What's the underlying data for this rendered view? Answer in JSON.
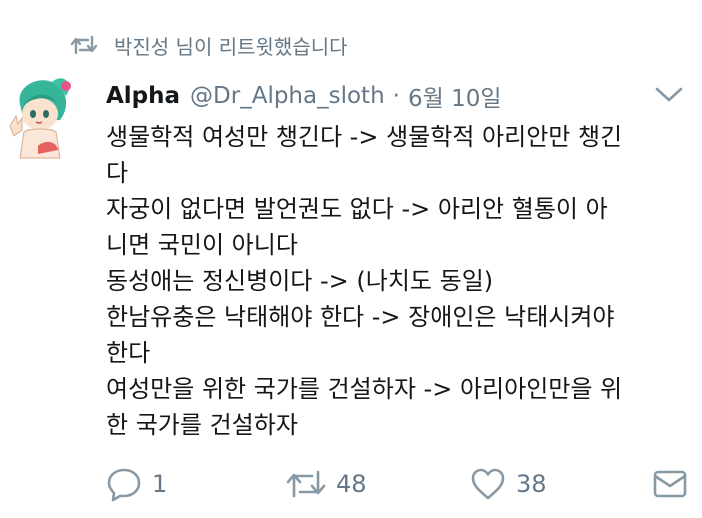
{
  "retweet_banner": {
    "icon": "retweet-icon",
    "text": "박진성 님이 리트윗했습니다"
  },
  "tweet": {
    "author_name": "Alpha",
    "author_handle": "@Dr_Alpha_sloth",
    "separator": "·",
    "date": "6월 10일",
    "lines": [
      "생물학적 여성만 챙긴다 -> 생물학적 아리안만 챙긴",
      "다",
      "자궁이 없다면 발언권도 없다 -> 아리안 혈통이 아",
      "니면 국민이 아니다",
      "동성애는 정신병이다 -> (나치도 동일)",
      "한남유충은 낙태해야 한다 -> 장애인은 낙태시켜야",
      "한다",
      "여성만을 위한 국가를 건설하자 -> 아리아인만을 위",
      "한 국가를 건설하자"
    ]
  },
  "actions": {
    "reply": {
      "icon": "reply-icon",
      "count": "1"
    },
    "retweet": {
      "icon": "retweet-icon",
      "count": "48"
    },
    "like": {
      "icon": "heart-icon",
      "count": "38"
    },
    "dm": {
      "icon": "envelope-icon"
    }
  },
  "colors": {
    "text_primary": "#14171a",
    "text_secondary": "#657786"
  }
}
